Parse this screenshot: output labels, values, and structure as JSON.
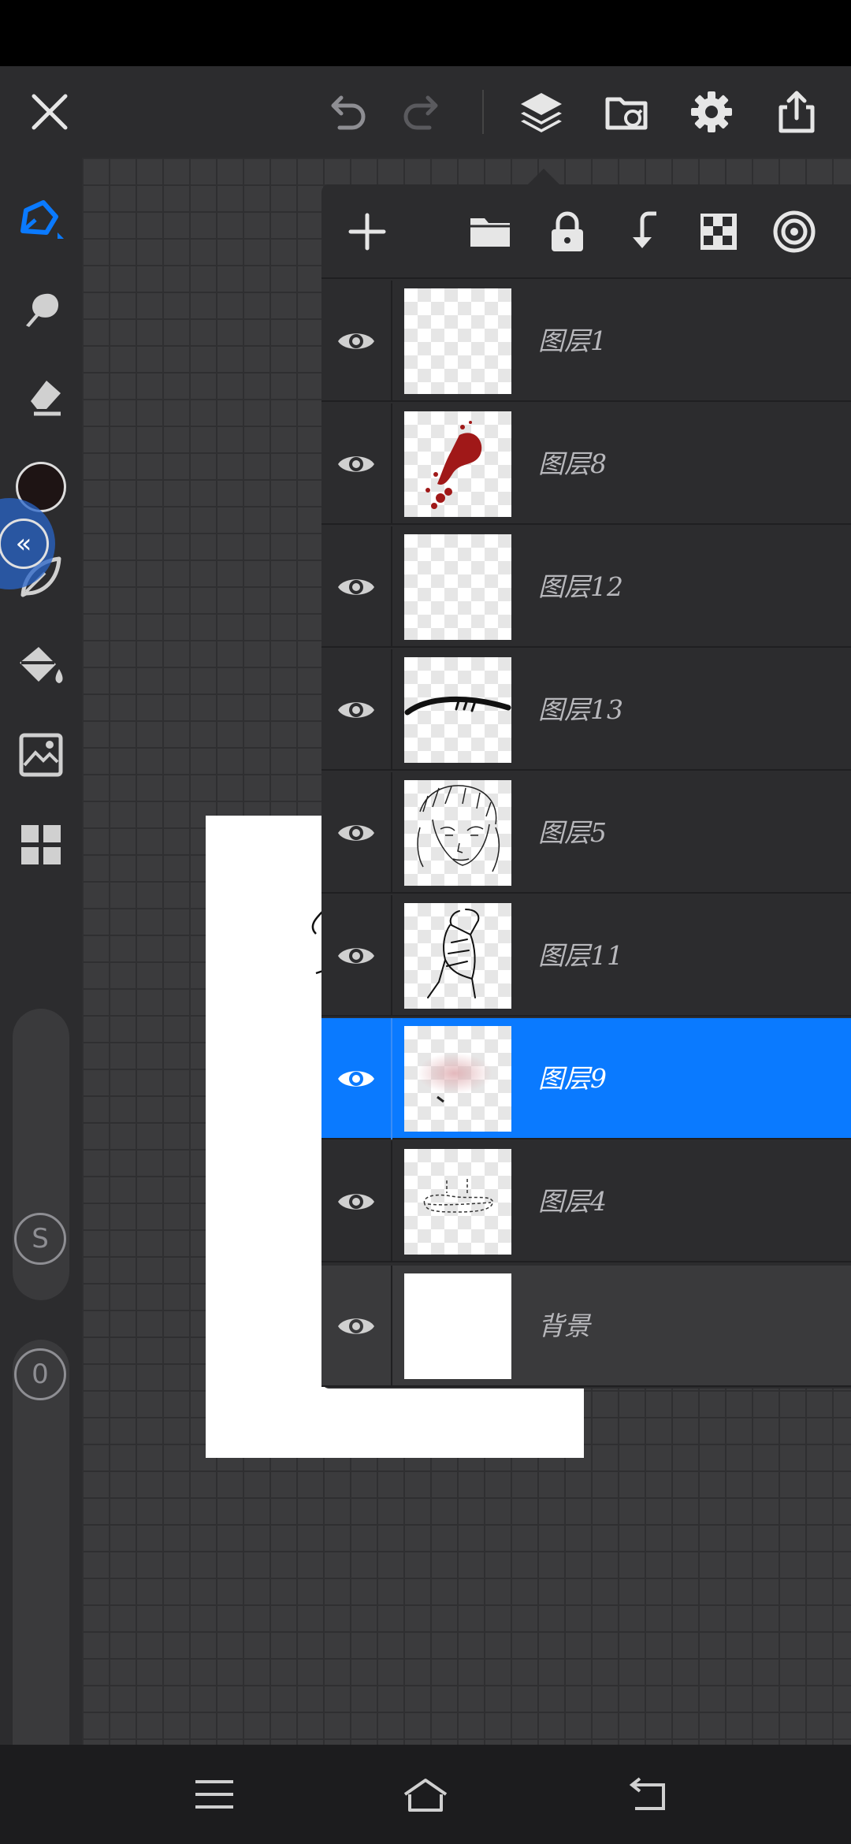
{
  "colors": {
    "accent": "#0a7aff",
    "brush_color": "#1e1414",
    "toolbar_bg": "#2c2c2e"
  },
  "top_toolbar": {
    "icons": [
      "close-icon",
      "undo-icon",
      "redo-icon",
      "layers-icon",
      "gallery-icon",
      "settings-icon",
      "share-icon"
    ]
  },
  "left_toolbar": {
    "tools": [
      "pen-tool-icon",
      "smudge-tool-icon",
      "eraser-tool-icon",
      "color-swatch",
      "leaf-brush-icon",
      "fill-bucket-icon",
      "image-import-icon",
      "grid-menu-icon"
    ],
    "size_badge": "S",
    "opacity_badge": "0"
  },
  "layers_panel": {
    "toolbar_icons": [
      "add-layer-icon",
      "folder-icon",
      "lock-icon",
      "merge-down-icon",
      "transparency-icon",
      "blend-mode-icon"
    ],
    "layers": [
      {
        "name": "图层1",
        "visible": true,
        "selected": false
      },
      {
        "name": "图层8",
        "visible": true,
        "selected": false
      },
      {
        "name": "图层12",
        "visible": true,
        "selected": false
      },
      {
        "name": "图层13",
        "visible": true,
        "selected": false
      },
      {
        "name": "图层5",
        "visible": true,
        "selected": false
      },
      {
        "name": "图层11",
        "visible": true,
        "selected": false
      },
      {
        "name": "图层9",
        "visible": true,
        "selected": true
      },
      {
        "name": "图层4",
        "visible": true,
        "selected": false
      },
      {
        "name": "背景",
        "visible": true,
        "selected": false
      }
    ]
  },
  "nav_bar": {
    "icons": [
      "menu-icon",
      "home-icon",
      "back-icon"
    ]
  }
}
